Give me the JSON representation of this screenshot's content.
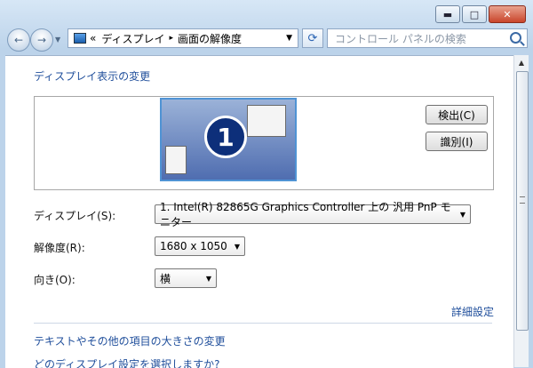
{
  "window": {
    "controls": {
      "minimize": "▬",
      "maximize": "□",
      "close": "✕"
    }
  },
  "navigation": {
    "back_icon": "←",
    "forward_icon": "→",
    "history_icon": "▼",
    "address_path_prefix": "«",
    "address_segment_1": "ディスプレイ",
    "address_separator": "▸",
    "address_segment_2": "画面の解像度",
    "address_dropdown_icon": "▼",
    "refresh_icon": "⟳",
    "search_placeholder": "コントロール パネルの検索"
  },
  "main": {
    "heading": "ディスプレイ表示の変更",
    "monitor_number": "1",
    "detect_button": "検出(C)",
    "identify_button": "識別(I)",
    "display_label": "ディスプレイ(S):",
    "display_value": "1. Intel(R) 82865G Graphics Controller 上の 汎用 PnP モニター",
    "resolution_label": "解像度(R):",
    "resolution_value": "1680 x 1050",
    "orientation_label": "向き(O):",
    "orientation_value": "横",
    "advanced_settings_link": "詳細設定",
    "text_size_link": "テキストやその他の項目の大きさの変更",
    "partial_link_text": "どのディスプレイ設定を選択しますか?"
  },
  "icons": {
    "dropdown": "▼",
    "scroll_up": "▲"
  },
  "colors": {
    "link": "#1f4e9b",
    "chrome": "#bcd3ea",
    "monitor": "#4f6db0"
  }
}
